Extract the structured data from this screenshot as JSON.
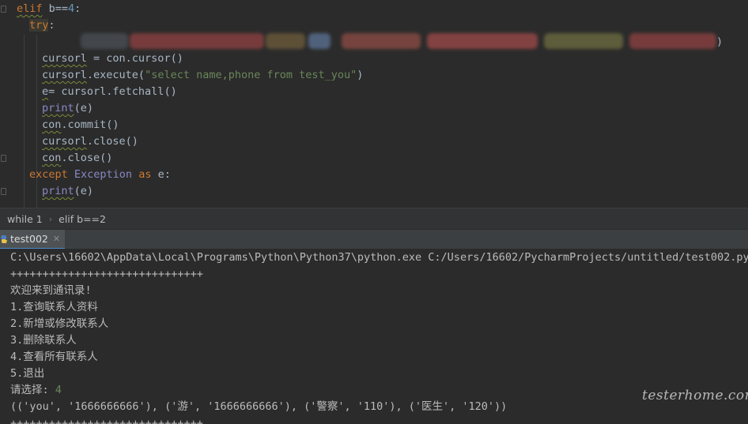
{
  "editor": {
    "lines": [
      {
        "parts": [
          {
            "t": "elif",
            "c": "kw sq"
          },
          {
            "t": " b==",
            "c": ""
          },
          {
            "t": "4",
            "c": "num"
          },
          {
            "t": ":",
            "c": ""
          }
        ]
      },
      {
        "parts": [
          {
            "t": "try",
            "c": "kw"
          },
          {
            "t": ":",
            "c": ""
          }
        ]
      },
      {
        "parts": []
      },
      {
        "parts": [
          {
            "t": "cursorl",
            "c": "sq"
          },
          {
            "t": " = con.cursor()",
            "c": ""
          }
        ]
      },
      {
        "parts": [
          {
            "t": "cursorl",
            "c": "sq"
          },
          {
            "t": ".execute(",
            "c": ""
          },
          {
            "t": "\"select name,phone from test_you\"",
            "c": "str"
          },
          {
            "t": ")",
            "c": ""
          }
        ]
      },
      {
        "parts": [
          {
            "t": "e",
            "c": "sq"
          },
          {
            "t": "= cursorl.fetchall()",
            "c": ""
          }
        ]
      },
      {
        "parts": [
          {
            "t": "print",
            "c": "bi sq"
          },
          {
            "t": "(e)",
            "c": ""
          }
        ]
      },
      {
        "parts": [
          {
            "t": "con",
            "c": "sq"
          },
          {
            "t": ".commit()",
            "c": ""
          }
        ]
      },
      {
        "parts": [
          {
            "t": "cursorl",
            "c": "sq"
          },
          {
            "t": ".close()",
            "c": ""
          }
        ]
      },
      {
        "parts": [
          {
            "t": "con",
            "c": "sq"
          },
          {
            "t": ".close()",
            "c": ""
          }
        ]
      },
      {
        "parts": [
          {
            "t": "except ",
            "c": "kw"
          },
          {
            "t": "Exception",
            "c": "bi"
          },
          {
            "t": " as ",
            "c": "kw"
          },
          {
            "t": "e:",
            "c": ""
          }
        ]
      },
      {
        "parts": [
          {
            "t": "print",
            "c": "bi sq"
          },
          {
            "t": "(e)",
            "c": ""
          }
        ]
      }
    ],
    "redacted_tail": ")"
  },
  "breadcrumb": {
    "items": [
      "while 1",
      "elif b==2"
    ]
  },
  "run_panel": {
    "tab_label": "test002",
    "close_glyph": "✕",
    "output": [
      "C:\\Users\\16602\\AppData\\Local\\Programs\\Python\\Python37\\python.exe C:/Users/16602/PycharmProjects/untitled/test002.py",
      "++++++++++++++++++++++++++++++",
      "欢迎来到通讯录!",
      "1.查询联系人资料",
      "2.新增或修改联系人",
      "3.删除联系人",
      "4.查看所有联系人",
      "5.退出",
      "请选择: ",
      "(('you', '1666666666'), ('游', '1666666666'), ('警察', '110'), ('医生', '120'))",
      "++++++++++++++++++++++++++++++"
    ],
    "input_value": "4"
  },
  "watermark": "testerhome.com",
  "colors": {
    "bg": "#2b2b2b",
    "keyword": "#cc7832",
    "string": "#6a8759",
    "number": "#6897bb",
    "builtin": "#8888c6",
    "accent": "#4a88c7"
  }
}
